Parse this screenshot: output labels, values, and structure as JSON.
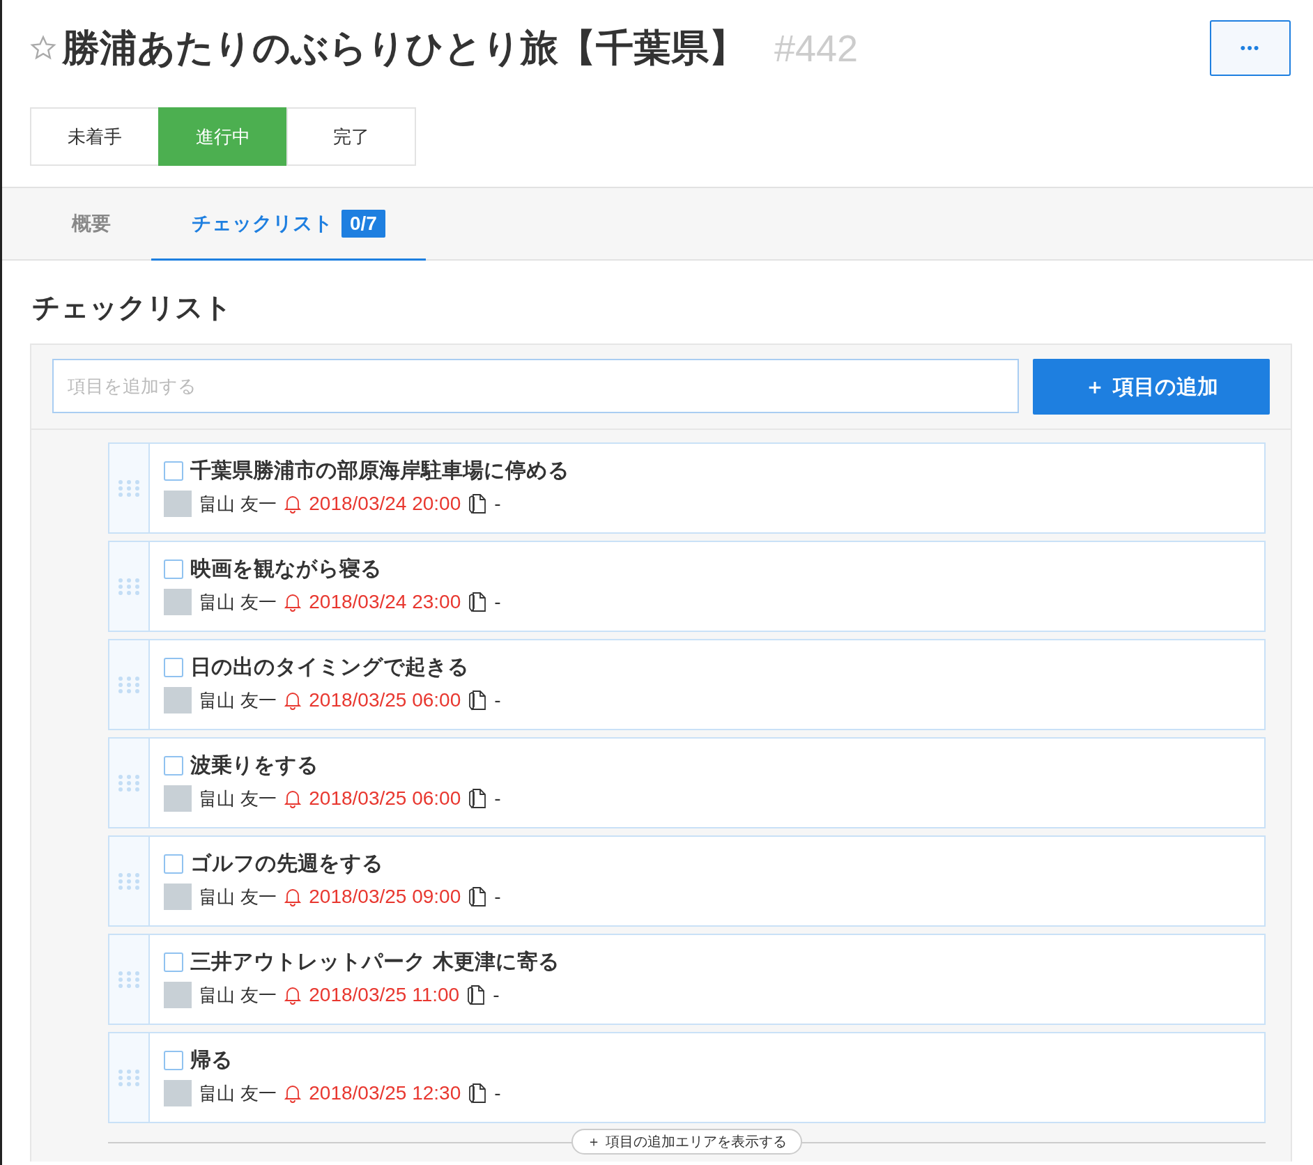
{
  "header": {
    "title": "勝浦あたりのぶらりひとり旅【千葉県】",
    "number": "#442",
    "starred": false,
    "menu_button": "•••"
  },
  "status_buttons": [
    {
      "label": "未着手",
      "selected": false
    },
    {
      "label": "進行中",
      "selected": true
    },
    {
      "label": "完了",
      "selected": false
    }
  ],
  "tabs": [
    {
      "label": "概要",
      "selected": false
    },
    {
      "label": "チェックリスト",
      "badge": "0/7",
      "selected": true
    }
  ],
  "section_title": "チェックリスト",
  "add_field": {
    "placeholder": "項目を追加する"
  },
  "add_button": {
    "icon": "＋",
    "label": "項目の追加"
  },
  "items": [
    {
      "title": "千葉県勝浦市の部原海岸駐車場に停める",
      "assignee": "畠山 友一",
      "due": "2018/03/24 20:00",
      "memo": "-",
      "checked": false
    },
    {
      "title": "映画を観ながら寝る",
      "assignee": "畠山 友一",
      "due": "2018/03/24 23:00",
      "memo": "-",
      "checked": false
    },
    {
      "title": "日の出のタイミングで起きる",
      "assignee": "畠山 友一",
      "due": "2018/03/25 06:00",
      "memo": "-",
      "checked": false
    },
    {
      "title": "波乗りをする",
      "assignee": "畠山 友一",
      "due": "2018/03/25 06:00",
      "memo": "-",
      "checked": false
    },
    {
      "title": "ゴルフの先週をする",
      "assignee": "畠山 友一",
      "due": "2018/03/25 09:00",
      "memo": "-",
      "checked": false
    },
    {
      "title": "三井アウトレットパーク 木更津に寄る",
      "assignee": "畠山 友一",
      "due": "2018/03/25 11:00",
      "memo": "-",
      "checked": false
    },
    {
      "title": "帰る",
      "assignee": "畠山 友一",
      "due": "2018/03/25 12:30",
      "memo": "-",
      "checked": false
    }
  ],
  "show_add_area": {
    "icon": "＋",
    "label": "項目の追加エリアを表示する"
  }
}
